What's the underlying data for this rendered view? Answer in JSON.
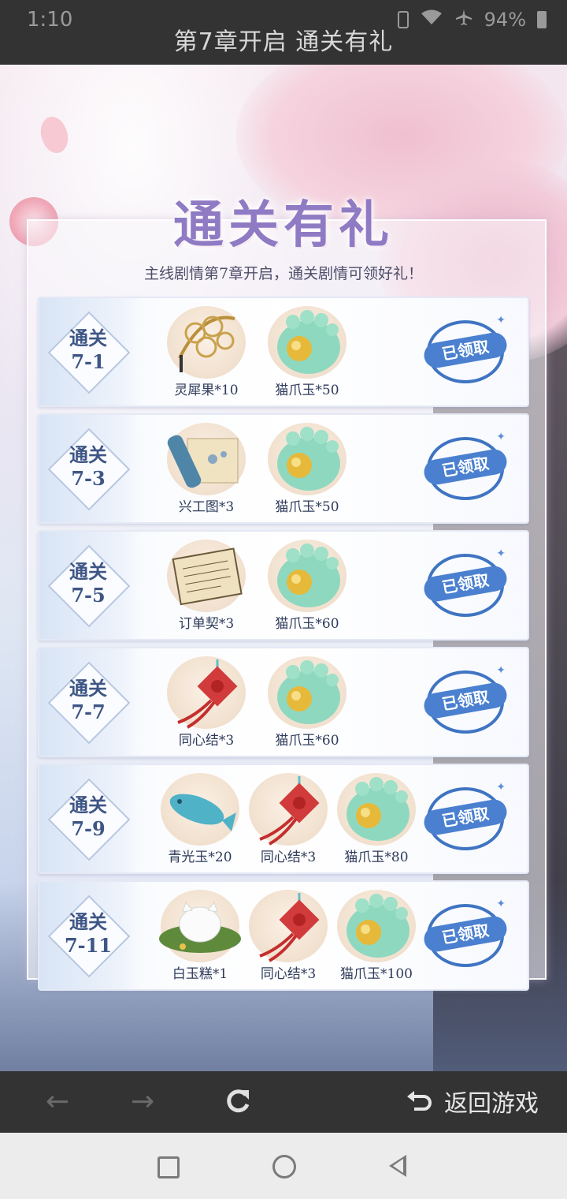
{
  "status_bar": {
    "time": "1:10",
    "battery": "94%"
  },
  "page_title": "第7章开启 通关有礼",
  "event": {
    "banner": "通关有礼",
    "subtitle": "主线剧情第7章开启，通关剧情可领好礼！",
    "rows": [
      {
        "stage": [
          "通关",
          "7-1"
        ],
        "rewards": [
          {
            "icon": "lingxi-fruit-icon",
            "label": "灵犀果*10"
          },
          {
            "icon": "cat-paw-jade-icon",
            "label": "猫爪玉*50"
          }
        ],
        "status": "已领取"
      },
      {
        "stage": [
          "通关",
          "7-3"
        ],
        "rewards": [
          {
            "icon": "scroll-icon",
            "label": "兴工图*3"
          },
          {
            "icon": "cat-paw-jade-icon",
            "label": "猫爪玉*50"
          }
        ],
        "status": "已领取"
      },
      {
        "stage": [
          "通关",
          "7-5"
        ],
        "rewards": [
          {
            "icon": "contract-icon",
            "label": "订单契*3"
          },
          {
            "icon": "cat-paw-jade-icon",
            "label": "猫爪玉*60"
          }
        ],
        "status": "已领取"
      },
      {
        "stage": [
          "通关",
          "7-7"
        ],
        "rewards": [
          {
            "icon": "chinese-knot-icon",
            "label": "同心结*3"
          },
          {
            "icon": "cat-paw-jade-icon",
            "label": "猫爪玉*60"
          }
        ],
        "status": "已领取"
      },
      {
        "stage": [
          "通关",
          "7-9"
        ],
        "rewards": [
          {
            "icon": "blue-fish-jade-icon",
            "label": "青光玉*20"
          },
          {
            "icon": "chinese-knot-icon",
            "label": "同心结*3"
          },
          {
            "icon": "cat-paw-jade-icon",
            "label": "猫爪玉*80"
          }
        ],
        "status": "已领取"
      },
      {
        "stage": [
          "通关",
          "7-11"
        ],
        "rewards": [
          {
            "icon": "white-jade-cake-icon",
            "label": "白玉糕*1"
          },
          {
            "icon": "chinese-knot-icon",
            "label": "同心结*3"
          },
          {
            "icon": "cat-paw-jade-icon",
            "label": "猫爪玉*100"
          }
        ],
        "status": "已领取"
      }
    ]
  },
  "toolbar": {
    "back_to_game_label": "返回游戏"
  },
  "colors": {
    "bar_bg": "#333333",
    "stamp_blue": "#4a80cf",
    "banner_purple": "#8f7bc4"
  }
}
